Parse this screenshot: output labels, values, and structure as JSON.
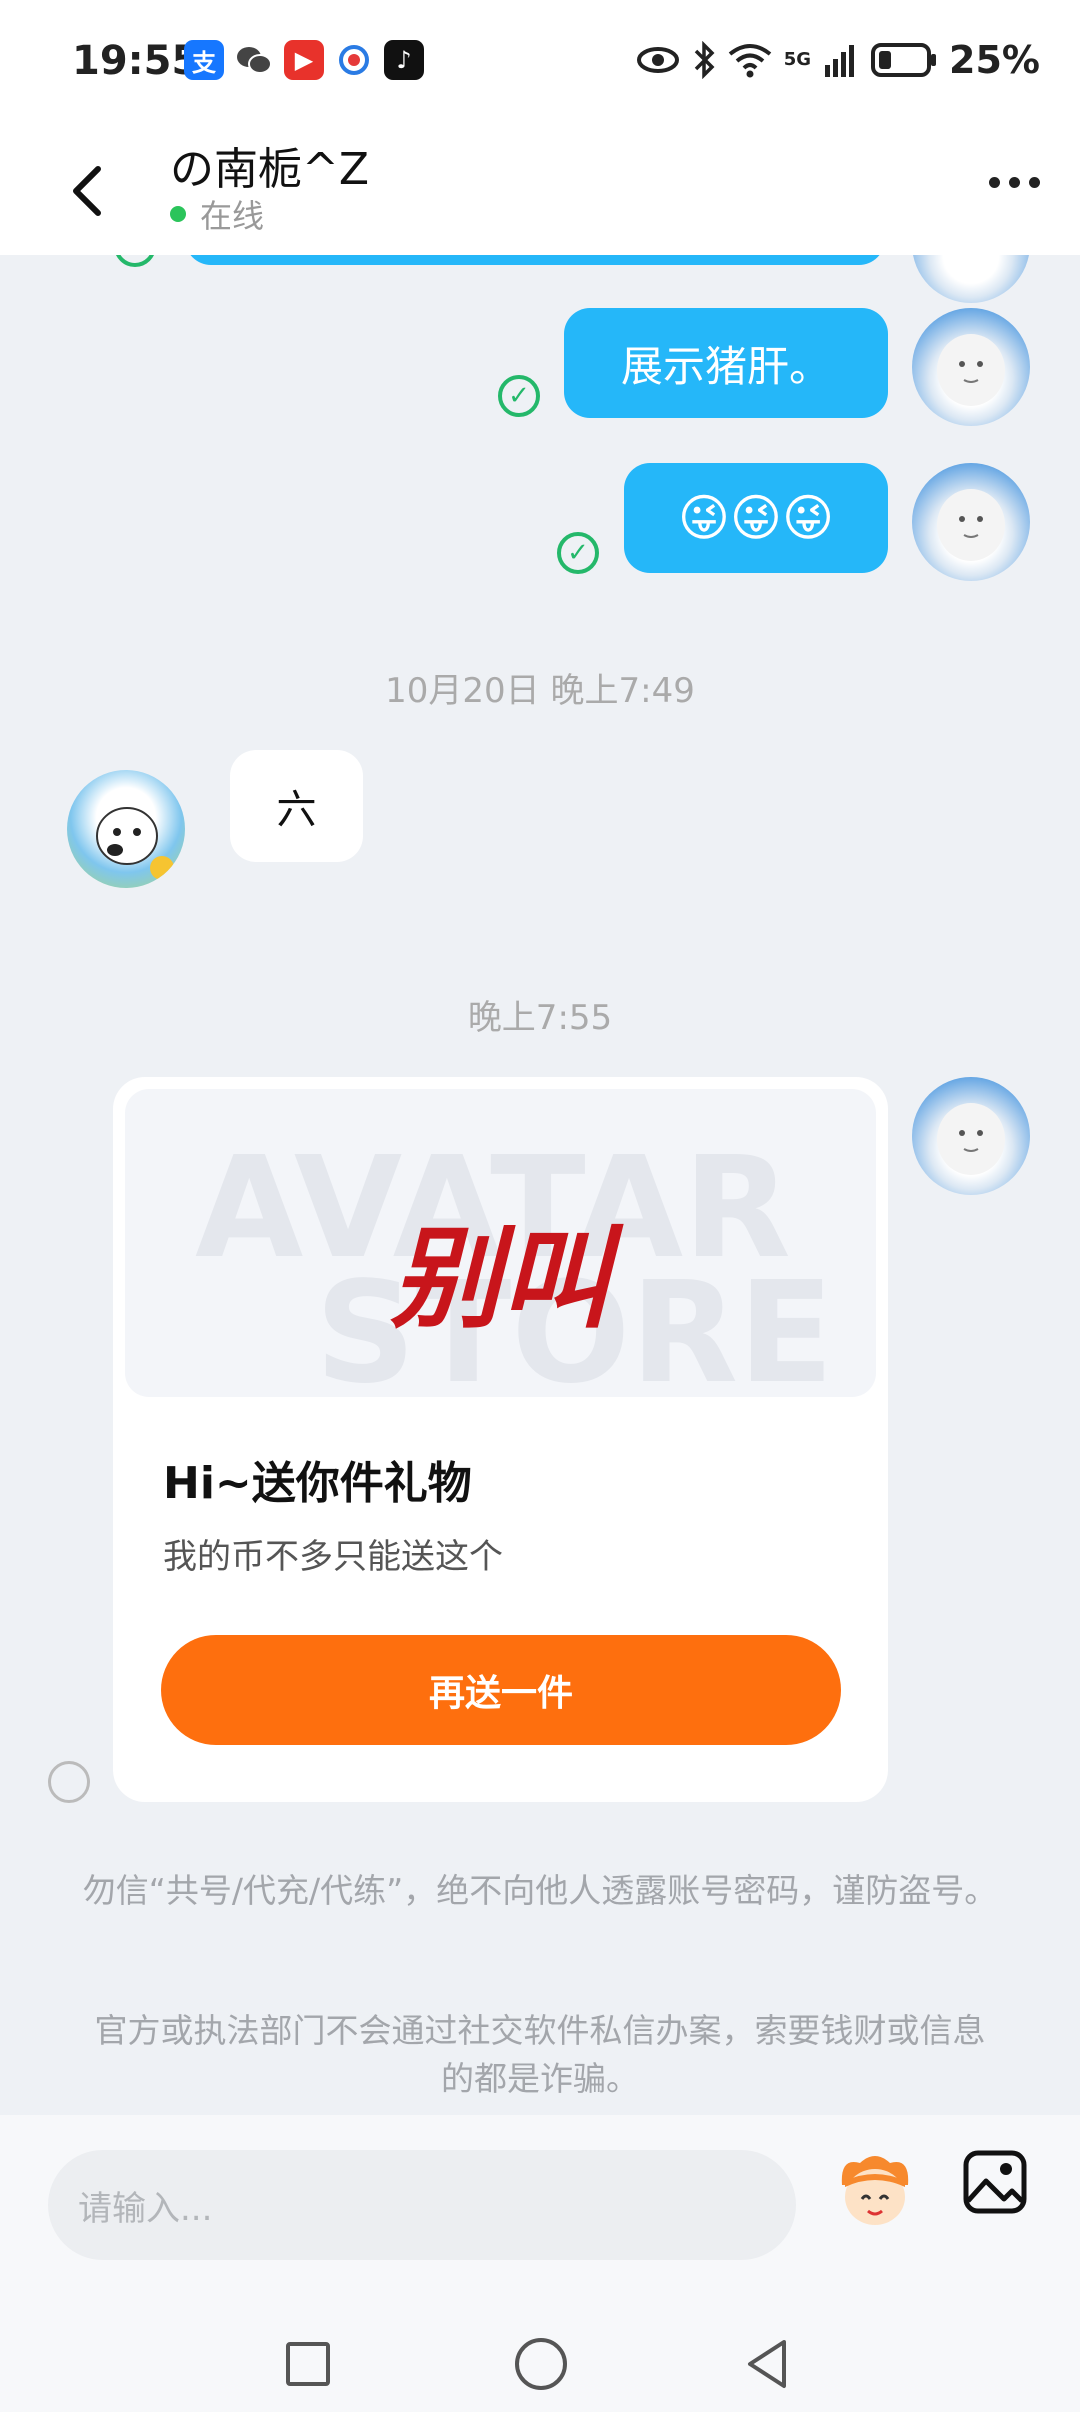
{
  "status_bar": {
    "time": "19:55",
    "apps": [
      {
        "name": "alipay-icon",
        "glyph": "支",
        "color": "#1677ff"
      },
      {
        "name": "wechat-icon",
        "glyph": "●",
        "color": "#555"
      },
      {
        "name": "video-app-icon",
        "glyph": "▶",
        "color": "#e8322b"
      },
      {
        "name": "browser-icon",
        "glyph": "◉",
        "color": "#888"
      },
      {
        "name": "tiktok-icon",
        "glyph": "♪",
        "color": "#111"
      }
    ],
    "signal": "5G",
    "battery": "25%"
  },
  "header": {
    "title": "の南栀^Z",
    "status": "在线"
  },
  "messages": {
    "m1_text": "展示猪肝。",
    "m2_text": "😜😜😜",
    "ts1": "10月20日 晚上7:49",
    "m3_text": "六",
    "ts2": "晚上7:55"
  },
  "gift_card": {
    "watermark_1": "AVATAR",
    "watermark_2": "STORE",
    "image_text": "别叫",
    "title": "Hi~送你件礼物",
    "subtitle": "我的币不多只能送这个",
    "button": "再送一件"
  },
  "notices": {
    "n1": "勿信“共号/代充/代练”，绝不向他人透露账号密码，谨防盗号。",
    "n2": "官方或执法部门不会通过社交软件私信办案，索要钱财或信息的都是诈骗。"
  },
  "input": {
    "placeholder": "请输入..."
  }
}
